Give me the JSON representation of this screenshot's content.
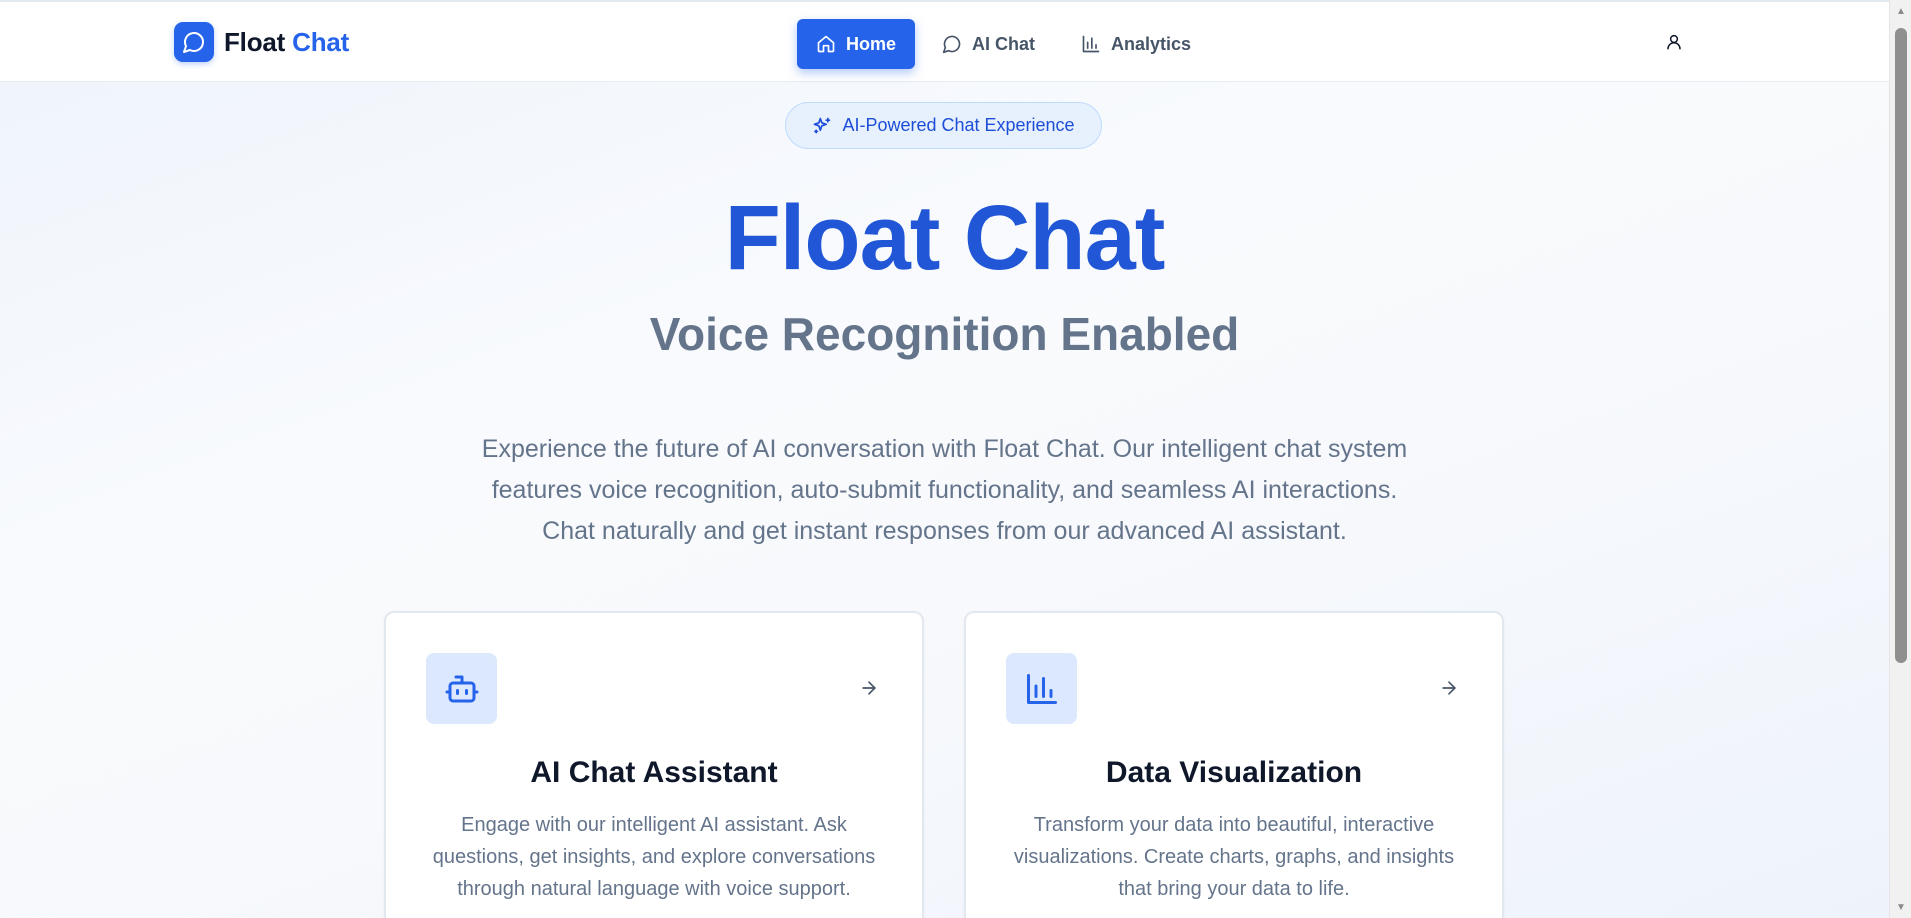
{
  "brand": {
    "name_main": "Float",
    "name_accent": "Chat"
  },
  "nav": {
    "items": [
      {
        "label": "Home",
        "icon": "home-icon",
        "active": true
      },
      {
        "label": "AI Chat",
        "icon": "chat-bubble-icon",
        "active": false
      },
      {
        "label": "Analytics",
        "icon": "bar-chart-icon",
        "active": false
      }
    ],
    "user_icon": "user-icon"
  },
  "hero": {
    "badge": "AI-Powered Chat Experience",
    "badge_icon": "sparkles-icon",
    "title": "Float Chat",
    "subtitle": "Voice Recognition Enabled",
    "description_lines": [
      "Experience the future of AI conversation with Float Chat. Our intelligent chat system",
      "features voice recognition, auto-submit functionality, and seamless AI interactions.",
      "Chat naturally and get instant responses from our advanced AI assistant."
    ]
  },
  "features": [
    {
      "icon": "bot-icon",
      "title": "AI Chat Assistant",
      "description_lines": [
        "Engage with our intelligent AI assistant. Ask",
        "questions, get insights, and explore conversations",
        "through natural language with voice support."
      ]
    },
    {
      "icon": "bar-chart-icon",
      "title": "Data Visualization",
      "description_lines": [
        "Transform your data into beautiful, interactive",
        "visualizations. Create charts, graphs, and insights",
        "that bring your data to life."
      ]
    }
  ],
  "colors": {
    "primary": "#2563eb",
    "title": "#2157d6",
    "muted_text": "#64748b",
    "badge_bg": "#e7f0fd",
    "icon_bg": "#dbe8fd"
  }
}
